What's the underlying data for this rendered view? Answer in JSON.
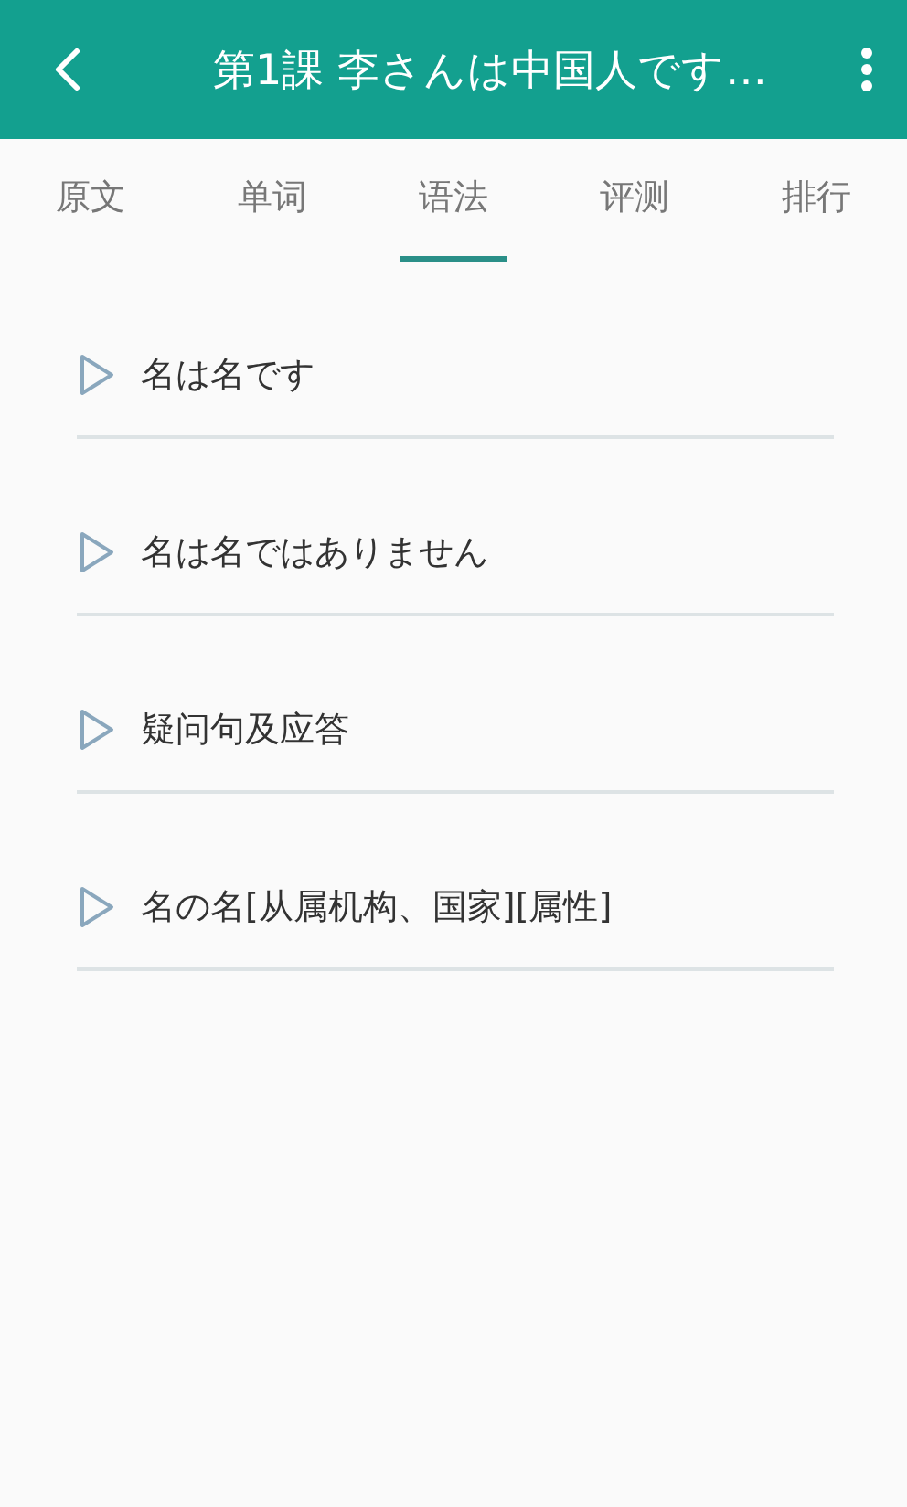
{
  "header": {
    "title": "第1課 李さんは中国人です…"
  },
  "tabs": [
    {
      "label": "原文",
      "selected": false
    },
    {
      "label": "单词",
      "selected": false
    },
    {
      "label": "语法",
      "selected": true
    },
    {
      "label": "评测",
      "selected": false
    },
    {
      "label": "排行",
      "selected": false
    }
  ],
  "grammar_items": [
    {
      "label": "名は名です"
    },
    {
      "label": "名は名ではありません"
    },
    {
      "label": "疑问句及应答"
    },
    {
      "label": "名の名[从属机构、国家][属性]"
    }
  ]
}
